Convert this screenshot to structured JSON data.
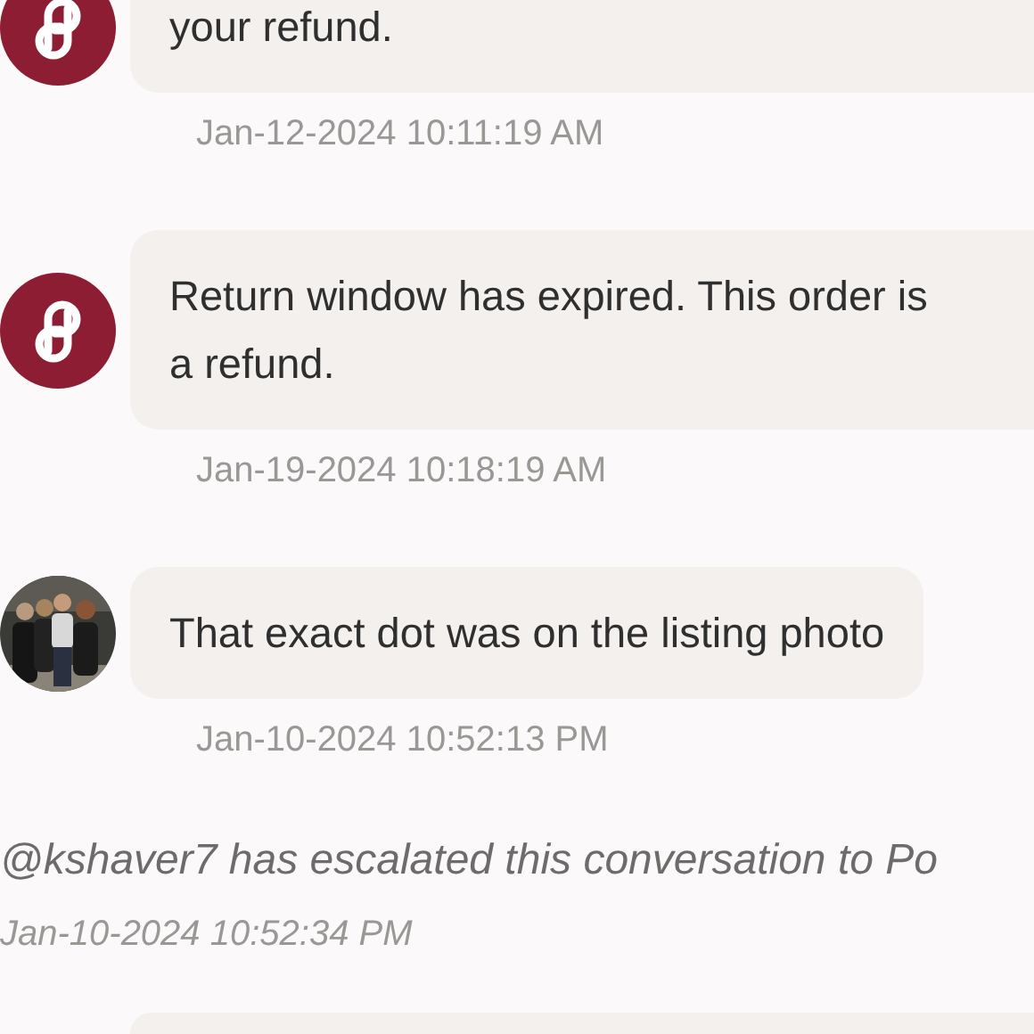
{
  "messages": [
    {
      "kind": "bot",
      "lines": [
        "your refund."
      ],
      "time": "Jan-12-2024 10:11:19 AM",
      "cut": true
    },
    {
      "kind": "bot",
      "lines": [
        "Return window has expired. This order is",
        "a refund."
      ],
      "time": "Jan-19-2024 10:18:19 AM",
      "cut": true
    },
    {
      "kind": "user",
      "lines": [
        "That exact dot was on the listing photo"
      ],
      "time": "Jan-10-2024 10:52:13 PM",
      "cut": false
    }
  ],
  "event": {
    "text": "@kshaver7 has escalated this conversation to Po",
    "time": "Jan-10-2024 10:52:34 PM"
  },
  "partial_bubble": true
}
